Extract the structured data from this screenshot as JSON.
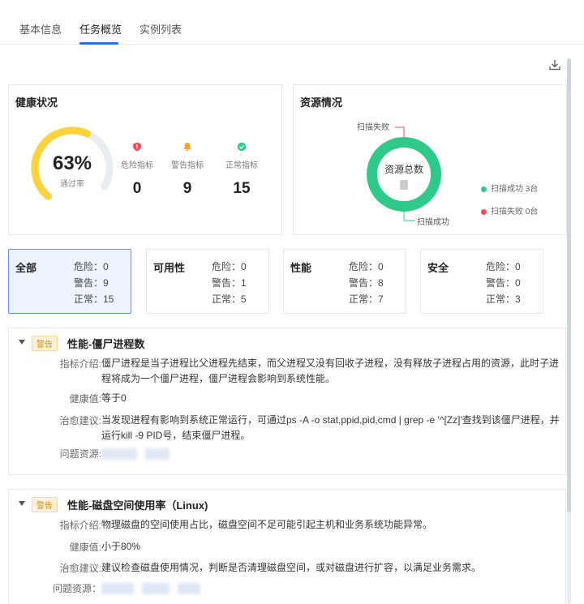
{
  "tabs": [
    {
      "label": "基本信息"
    },
    {
      "label": "任务概览"
    },
    {
      "label": "实例列表"
    }
  ],
  "active_tab": "任务概览",
  "health": {
    "title": "健康状况",
    "pass_rate_label": "63%",
    "pass_rate": 0.63,
    "pass_rate_caption": "通过率",
    "metrics": [
      {
        "label": "危险指标",
        "value": "0",
        "color": "#f5475a",
        "icon": "shield-alert-icon"
      },
      {
        "label": "警告指标",
        "value": "9",
        "color": "#f5a623",
        "icon": "bell-icon"
      },
      {
        "label": "正常指标",
        "value": "15",
        "color": "#2fc98a",
        "icon": "check-circle-icon"
      }
    ]
  },
  "resource": {
    "title": "资源情况",
    "center_label": "资源总数",
    "fail_callout": "扫描失败",
    "success_callout": "扫描成功",
    "legend": [
      {
        "label": "扫描成功 3台",
        "color": "#2fc98a"
      },
      {
        "label": "扫描失败 0台",
        "color": "#f5475a"
      }
    ]
  },
  "categories": [
    {
      "name": "全部",
      "danger": "危险：0",
      "warning": "警告：9",
      "normal": "正常：15"
    },
    {
      "name": "可用性",
      "danger": "危险：0",
      "warning": "警告：1",
      "normal": "正常：5"
    },
    {
      "name": "性能",
      "danger": "危险：0",
      "warning": "警告：8",
      "normal": "正常：7"
    },
    {
      "name": "安全",
      "danger": "危险：0",
      "warning": "警告：0",
      "normal": "正常：3"
    }
  ],
  "labels": {
    "intro": "指标介绍:",
    "health_value": "健康值:",
    "advice": "治愈建议:",
    "resource": "问题资源:",
    "resource_full": "问题资源："
  },
  "issues": [
    {
      "tag": "警告",
      "title": "性能-僵尸进程数",
      "intro": "僵尸进程是当子进程比父进程先结束，而父进程又没有回收子进程，没有释放子进程占用的资源，此时子进程将成为一个僵尸进程，僵尸进程会影响到系统性能。",
      "health_value": "等于0",
      "advice": "当发现进程有影响到系统正常运行，可通过ps -A -o stat,ppid,pid,cmd | grep -e '^[Zz]'查找到该僵尸进程，并运行kill -9 PID号，结束僵尸进程。"
    },
    {
      "tag": "警告",
      "title": "性能-磁盘空间使用率（Linux)",
      "intro": "物理磁盘的空间使用占比，磁盘空间不足可能引起主机和业务系统功能异常。",
      "health_value": "小于80%",
      "advice": "建议检查磁盘使用情况，判断是否清理磁盘空间，或对磁盘进行扩容，以满足业务需求。"
    }
  ],
  "colors": {
    "accent": "#2a6ee8",
    "gauge": "#fcd33a",
    "gauge_track": "#e8ebf0",
    "donut": "#2fc98a",
    "tag_warning": "#d48806"
  }
}
